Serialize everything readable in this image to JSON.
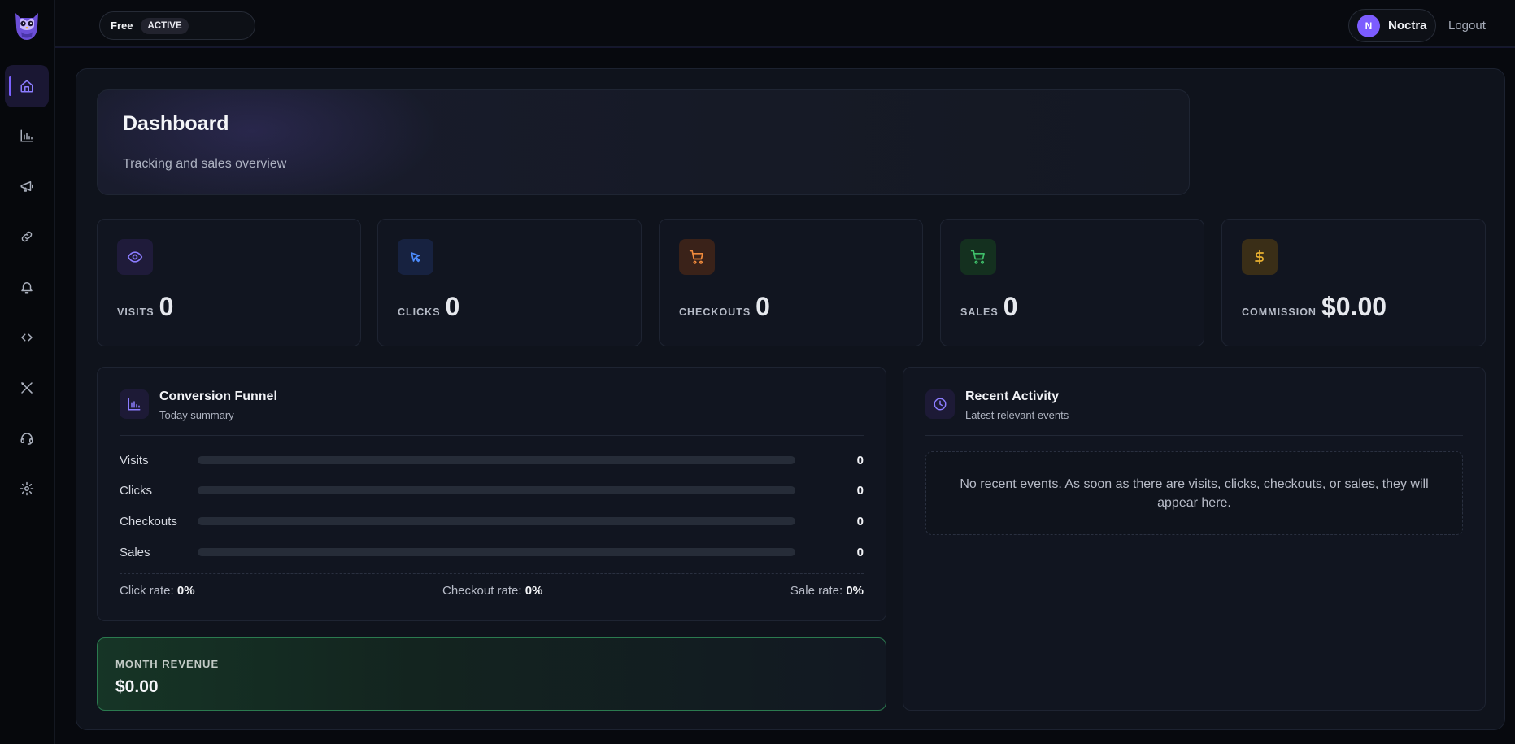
{
  "topbar": {
    "plan_name": "Free",
    "plan_status": "ACTIVE",
    "user_initial": "N",
    "user_name": "Noctra",
    "logout_label": "Logout"
  },
  "sidebar": {
    "items": [
      {
        "name": "home",
        "icon": "home-icon",
        "active": true
      },
      {
        "name": "analytics",
        "icon": "bar-chart-icon",
        "active": false
      },
      {
        "name": "campaigns",
        "icon": "megaphone-icon",
        "active": false
      },
      {
        "name": "links",
        "icon": "link-icon",
        "active": false
      },
      {
        "name": "notifications",
        "icon": "bell-icon",
        "active": false
      },
      {
        "name": "integrations",
        "icon": "code-icon",
        "active": false
      },
      {
        "name": "tools",
        "icon": "tools-icon",
        "active": false
      },
      {
        "name": "support",
        "icon": "headset-icon",
        "active": false
      },
      {
        "name": "settings",
        "icon": "gear-icon",
        "active": false
      }
    ]
  },
  "header": {
    "title": "Dashboard",
    "subtitle": "Tracking and sales overview"
  },
  "stats": [
    {
      "label": "VISITS",
      "value": "0",
      "icon": "eye-icon",
      "color": "#8b7cff"
    },
    {
      "label": "CLICKS",
      "value": "0",
      "icon": "cursor-icon",
      "color": "#4d8dff"
    },
    {
      "label": "CHECKOUTS",
      "value": "0",
      "icon": "cart-icon",
      "color": "#f08a3c"
    },
    {
      "label": "SALES",
      "value": "0",
      "icon": "cart-icon",
      "color": "#3fbf6a"
    },
    {
      "label": "COMMISSION",
      "value": "$0.00",
      "icon": "dollar-icon",
      "color": "#e8b030"
    }
  ],
  "funnel": {
    "title": "Conversion Funnel",
    "subtitle": "Today summary",
    "rows": [
      {
        "label": "Visits",
        "value": "0",
        "fill": 0
      },
      {
        "label": "Clicks",
        "value": "0",
        "fill": 0
      },
      {
        "label": "Checkouts",
        "value": "0",
        "fill": 0
      },
      {
        "label": "Sales",
        "value": "0",
        "fill": 0
      }
    ],
    "rates": {
      "click_label": "Click rate:",
      "click_value": "0%",
      "checkout_label": "Checkout rate:",
      "checkout_value": "0%",
      "sale_label": "Sale rate:",
      "sale_value": "0%"
    }
  },
  "revenue": {
    "label": "MONTH REVENUE",
    "value": "$0.00"
  },
  "activity": {
    "title": "Recent Activity",
    "subtitle": "Latest relevant events",
    "empty_message": "No recent events. As soon as there are visits, clicks, checkouts, or sales, they will appear here."
  },
  "colors": {
    "accent": "#7c5cff",
    "revenue_border": "#2b7a4f"
  }
}
